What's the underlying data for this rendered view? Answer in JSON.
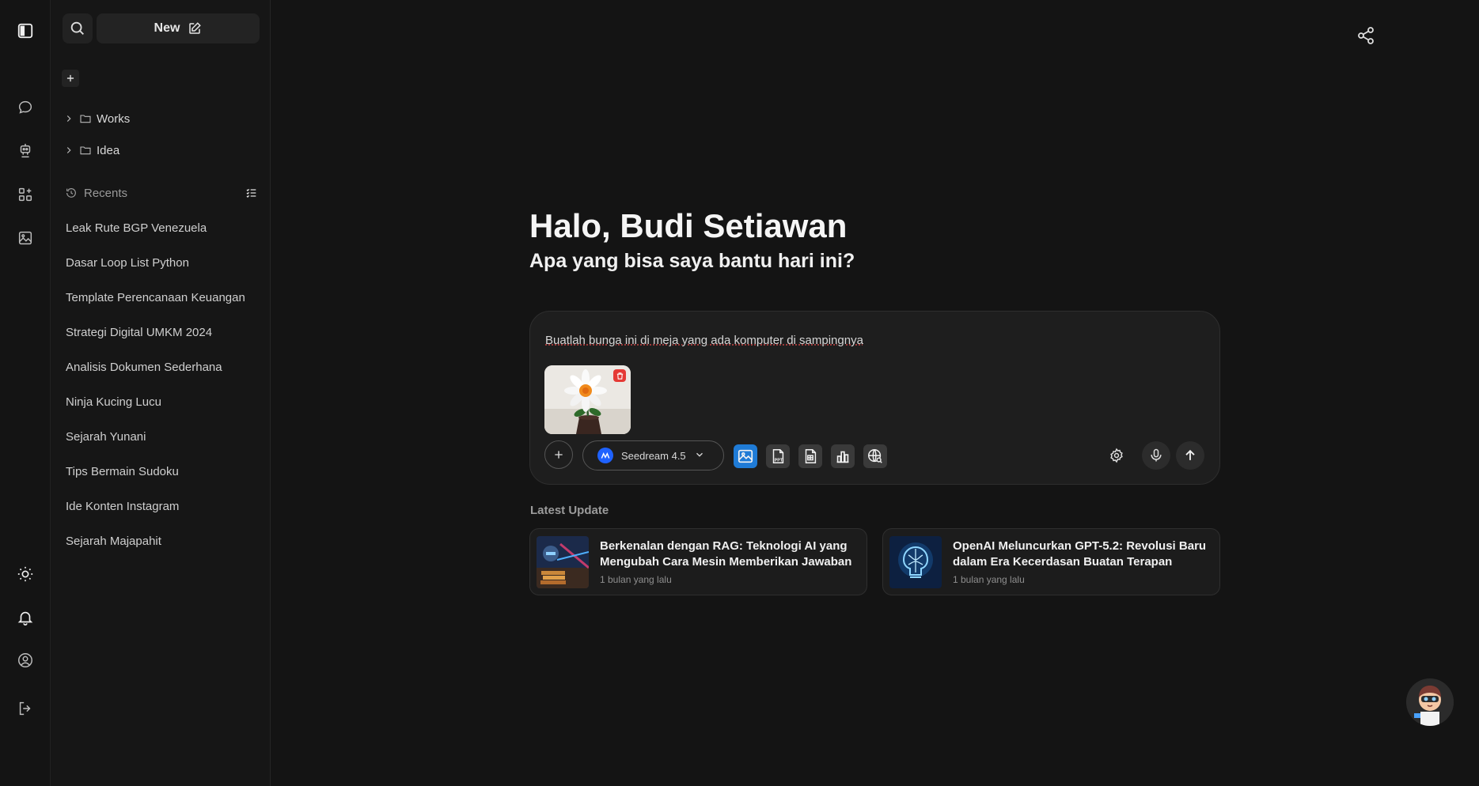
{
  "sidebar": {
    "new_label": "New",
    "folders": [
      {
        "label": "Works"
      },
      {
        "label": "Idea"
      }
    ],
    "recents_label": "Recents",
    "recents": [
      "Leak Rute BGP Venezuela",
      "Dasar Loop List Python",
      "Template Perencanaan Keuangan",
      "Strategi Digital UMKM 2024",
      "Analisis Dokumen Sederhana",
      "Ninja Kucing Lucu",
      "Sejarah Yunani",
      "Tips Bermain Sudoku",
      "Ide Konten Instagram",
      "Sejarah Majapahit"
    ]
  },
  "main": {
    "greeting": "Halo, Budi Setiawan",
    "subgreeting": "Apa yang bisa saya bantu hari ini?",
    "composer": {
      "prompt": "Buatlah bunga ini di meja yang ada komputer di sampingnya",
      "model": "Seedream 4.5",
      "tools": [
        "image-icon",
        "ppt-icon",
        "spreadsheet-icon",
        "chart-icon",
        "web-search-icon"
      ]
    },
    "latest_update_label": "Latest Update",
    "updates": [
      {
        "title": "Berkenalan dengan RAG: Teknologi AI yang Mengubah Cara Mesin Memberikan Jawaban",
        "time": "1 bulan yang lalu"
      },
      {
        "title": "OpenAI Meluncurkan GPT-5.2: Revolusi Baru dalam Era Kecerdasan Buatan Terapan",
        "time": "1 bulan yang lalu"
      }
    ]
  },
  "colors": {
    "background": "#141414",
    "sidebar": "#161616",
    "accent": "#1f7bd6",
    "delete": "#e53935"
  }
}
